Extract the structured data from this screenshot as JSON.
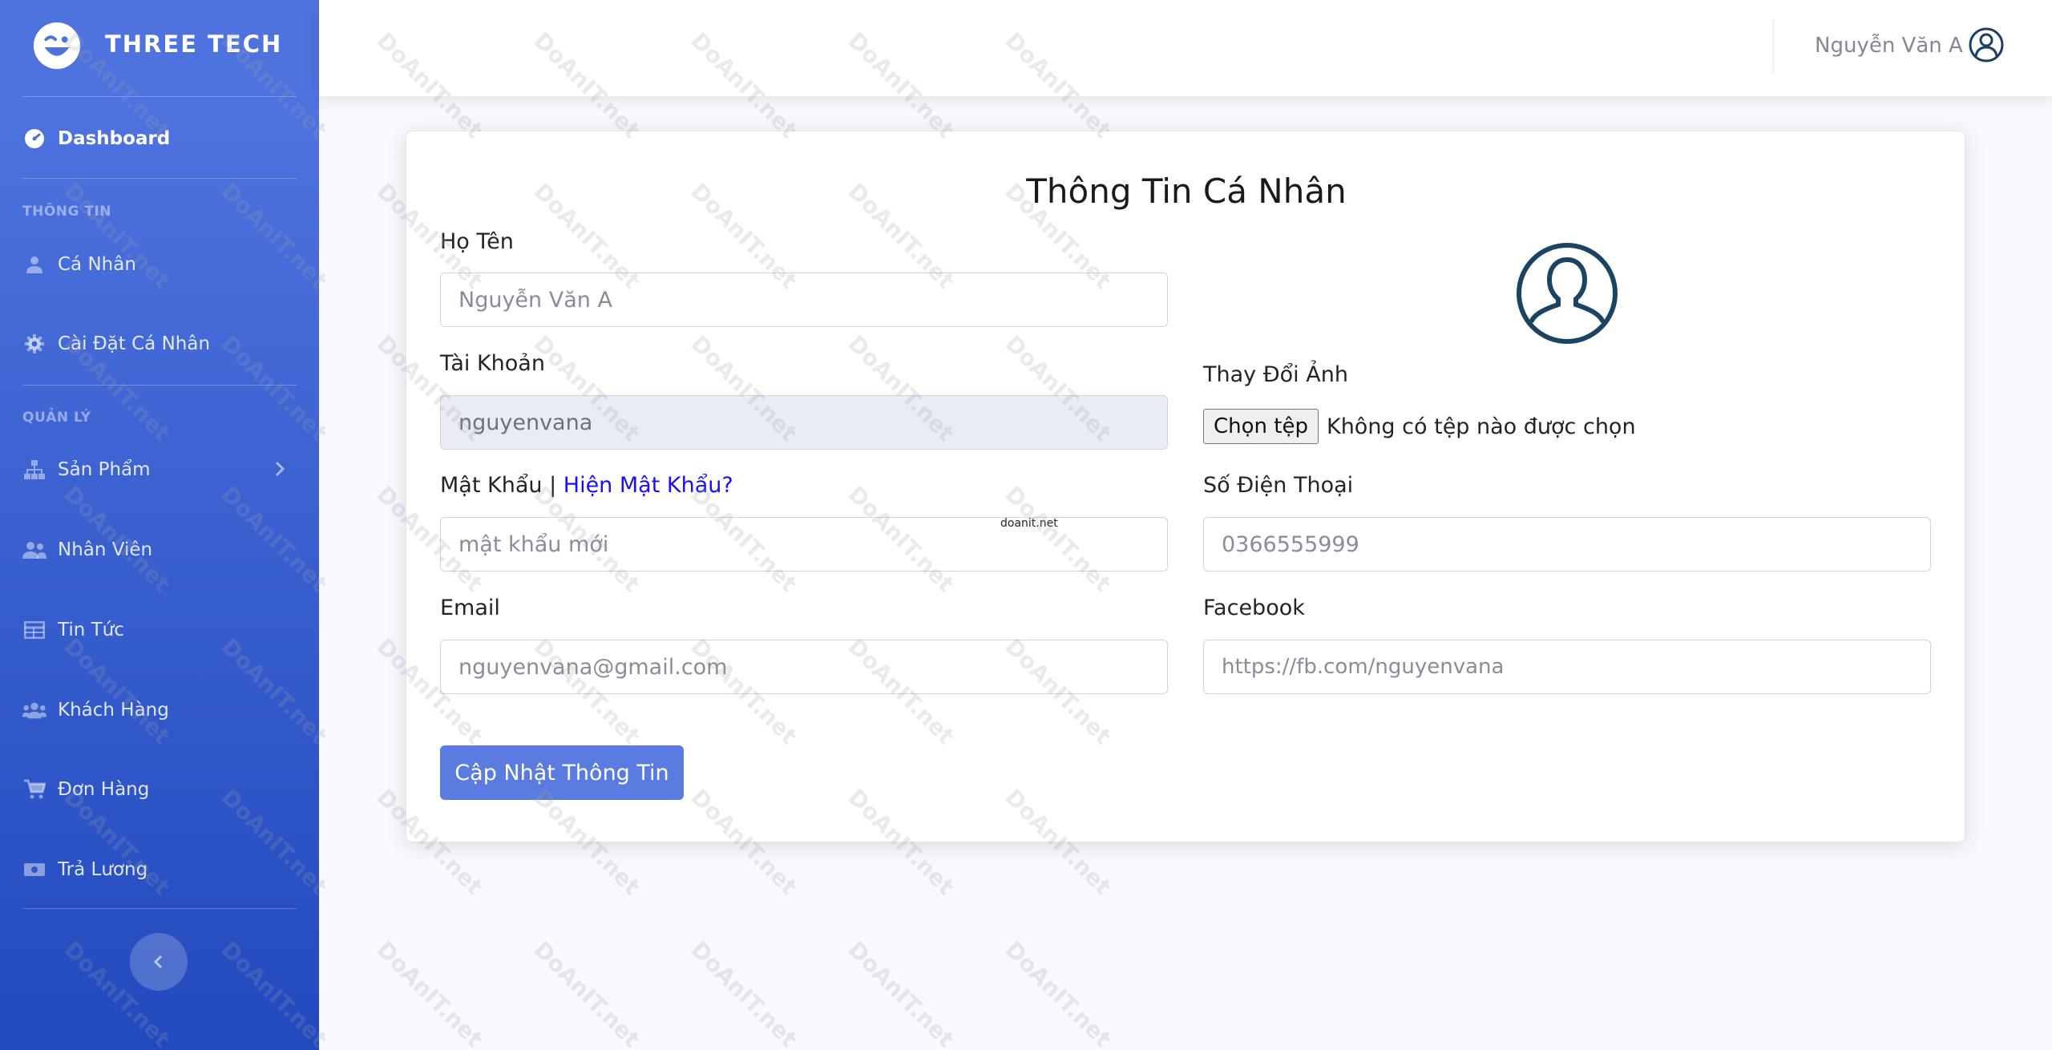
{
  "brand": {
    "name": "THREE TECH"
  },
  "sidebar": {
    "dashboard": "Dashboard",
    "heading_info": "THÔNG TIN",
    "heading_manage": "QUẢN LÝ",
    "items": [
      {
        "label": "Cá Nhân",
        "icon": "user-icon"
      },
      {
        "label": "Cài Đặt Cá Nhân",
        "icon": "gear-icon"
      },
      {
        "label": "Sản Phẩm",
        "icon": "sitemap-icon"
      },
      {
        "label": "Nhân Viên",
        "icon": "users-icon"
      },
      {
        "label": "Tin Tức",
        "icon": "table-icon"
      },
      {
        "label": "Khách Hàng",
        "icon": "user-group-icon"
      },
      {
        "label": "Đơn Hàng",
        "icon": "cart-icon"
      },
      {
        "label": "Trả Lương",
        "icon": "money-icon"
      }
    ]
  },
  "topbar": {
    "user_name": "Nguyễn Văn A"
  },
  "form": {
    "title": "Thông Tin Cá Nhân",
    "fullname_label": "Họ Tên",
    "fullname_placeholder": "Nguyễn Văn A",
    "account_label": "Tài Khoản",
    "account_value": "nguyenvana",
    "password_label": "Mật Khẩu |",
    "password_show_link": "Hiện Mật Khẩu?",
    "password_placeholder": "mật khẩu mới",
    "email_label": "Email",
    "email_placeholder": "nguyenvana@gmail.com",
    "change_photo_label": "Thay Đổi Ảnh",
    "file_button": "Chọn tệp",
    "file_status": "Không có tệp nào được chọn",
    "phone_label": "Số Điện Thoại",
    "phone_placeholder": "0366555999",
    "facebook_label": "Facebook",
    "facebook_placeholder": "https://fb.com/nguyenvana",
    "submit": "Cập Nhật Thông Tin"
  },
  "watermark": {
    "text": "DoAnIT.net",
    "small": "doanit.net"
  },
  "colors": {
    "sidebar_top": "#4e73df",
    "sidebar_bottom": "#224abe",
    "button": "#5a7be0",
    "link": "#1a0dff"
  }
}
